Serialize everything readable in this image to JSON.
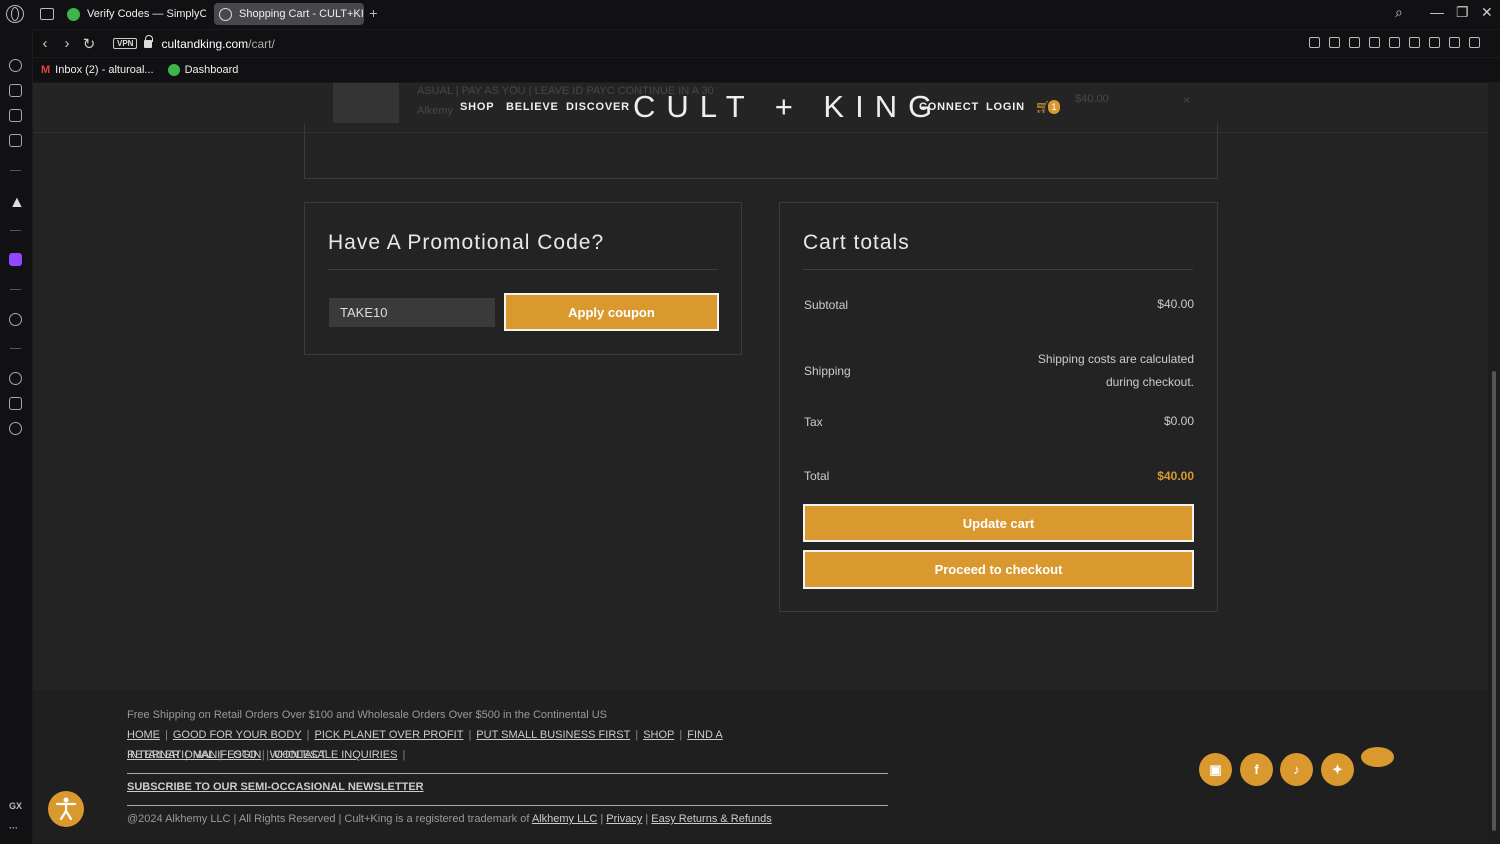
{
  "browser": {
    "tabs": [
      {
        "label": "Verify Codes — SimplyCo",
        "active": false
      },
      {
        "label": "Shopping Cart - CULT+KI",
        "active": true
      }
    ],
    "new_tab": "+",
    "url_domain": "cultandking.com",
    "url_path": "/cart/",
    "vpn_label": "VPN",
    "bookmarks": [
      {
        "label": "Inbox (2) - alturoal...",
        "icon": "gmail-icon"
      },
      {
        "label": "Dashboard",
        "icon": "dashboard-icon"
      }
    ],
    "sidebar_bottom_label": "GX"
  },
  "header": {
    "nav_left": [
      "SHOP",
      "BELIEVE",
      "DISCOVER"
    ],
    "logo": "CULT + KING",
    "nav_right": [
      "CONNECT",
      "LOGIN"
    ],
    "cart_count": "1",
    "ghost_row": {
      "title": "ASUAL | PAY AS YOU | LEAVE ID PAYC CONTINUE IN A 30",
      "subtitle": "Alkemy",
      "price": "$40.00",
      "remove": "×"
    }
  },
  "promo": {
    "heading": "Have A Promotional Code?",
    "coupon_value": "TAKE10",
    "apply_label": "Apply coupon"
  },
  "totals": {
    "heading": "Cart totals",
    "subtotal_label": "Subtotal",
    "subtotal_value": "$40.00",
    "shipping_label": "Shipping",
    "shipping_line1": "Shipping costs are calculated",
    "shipping_line2": "during checkout.",
    "tax_label": "Tax",
    "tax_value": "$0.00",
    "total_label": "Total",
    "total_value": "$40.00",
    "update_label": "Update cart",
    "checkout_label": "Proceed to checkout"
  },
  "footer": {
    "shipping_note": "Free Shipping on Retail Orders Over $100 and Wholesale Orders Over $500 in the Continental US",
    "links": [
      "HOME",
      "GOOD FOR YOUR BODY",
      "PICK PLANET OVER PROFIT",
      "PUT SMALL BUSINESS FIRST",
      "SHOP",
      "FIND A RETAILER",
      "MANIFESTO",
      "WHOLESALE INQUIRIES",
      "INTERNATIONAL",
      "LOGIN",
      "CONTACT"
    ],
    "newsletter": "SUBSCRIBE TO OUR SEMI-OCCASIONAL NEWSLETTER",
    "copyright": "@2024 Alkhemy LLC | All Rights Reserved | Cult+King is a registered trademark of",
    "trademark_link": "Alkhemy LLC",
    "privacy": "Privacy",
    "returns": "Easy Returns & Refunds",
    "social_icons": [
      "instagram-icon",
      "facebook-icon",
      "tiktok-icon",
      "twitter-icon"
    ]
  },
  "colors": {
    "accent": "#d9992f",
    "page_bg": "#232323",
    "chrome_bg": "#111113"
  }
}
